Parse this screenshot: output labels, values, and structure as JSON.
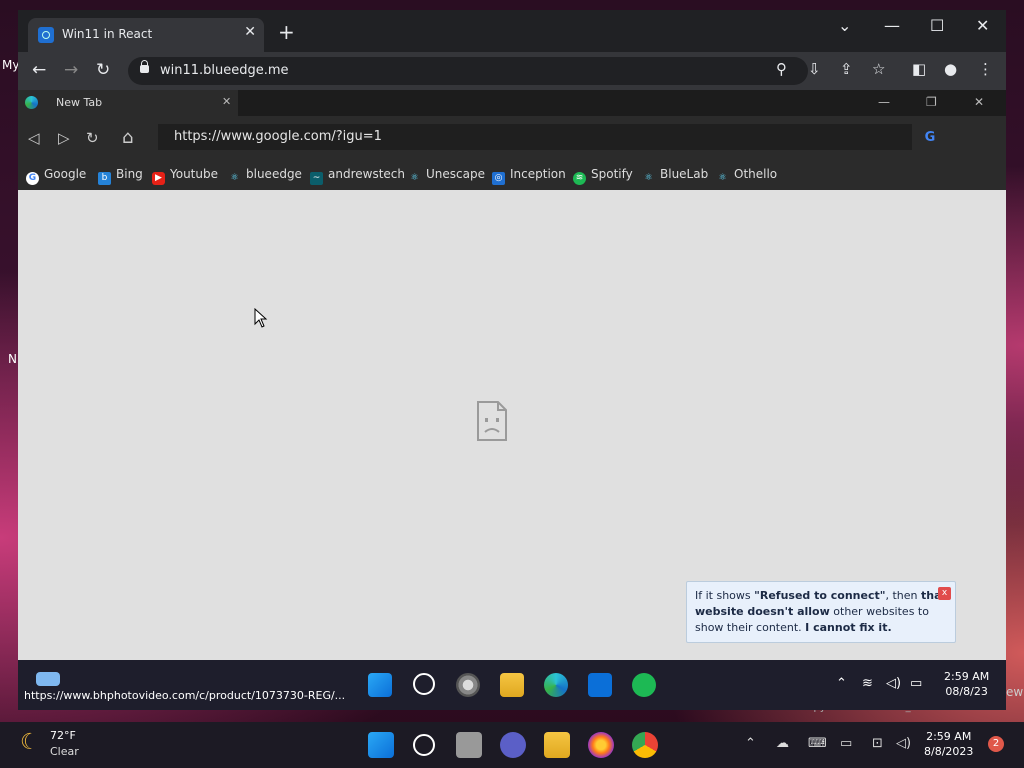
{
  "desktop": {
    "left_text_1": "My",
    "left_text_2": "N",
    "right_text": "ew",
    "watermark": "Evaluation copy. Build 23575.zn_release.230    1032"
  },
  "chrome": {
    "tab_title": "Win11 in React",
    "new_tab_symbol": "+",
    "url": "win11.blueedge.me"
  },
  "inner_browser": {
    "tab_title": "New Tab",
    "url": "https://www.google.com/?igu=1",
    "bookmarks": [
      "Google",
      "Bing",
      "Youtube",
      "blueedge",
      "andrewstech",
      "Unescape",
      "Inception",
      "Spotify",
      "BlueLab",
      "Othello"
    ],
    "info_part1": "If it shows ",
    "info_bold1": "\"Refused to connect\"",
    "info_part2": ", then ",
    "info_bold2": "that website doesn't allow",
    "info_part3": " other websites to show their content. ",
    "info_bold3": "I cannot fix it."
  },
  "inner_taskbar": {
    "status_url": "https://www.bhphotovideo.com/c/product/1073730-REG/...",
    "time": "2:59 AM",
    "date": "08/8/23"
  },
  "taskbar": {
    "temperature": "72°F",
    "condition": "Clear",
    "time": "2:59 AM",
    "date": "8/8/2023",
    "notification_count": "2"
  },
  "colors": {
    "chrome_bg": "#202124",
    "toolbar_bg": "#35363a",
    "content_bg": "#e0e0e0",
    "info_bg": "#e8f0fb",
    "close_red": "#e14c4c"
  }
}
